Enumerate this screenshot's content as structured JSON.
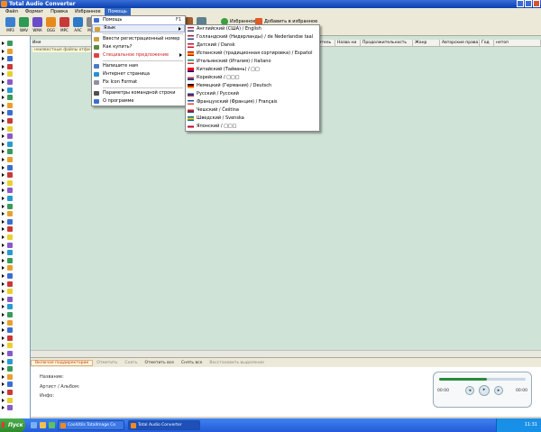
{
  "window": {
    "title": "Total Audio Converter"
  },
  "menubar": [
    "Файл",
    "Формат",
    "Правка",
    "Избранное",
    "Помощь"
  ],
  "toolbar": {
    "tools": [
      {
        "label": "MP3",
        "color": "#3a7fd0"
      },
      {
        "label": "WAV",
        "color": "#2f9a55"
      },
      {
        "label": "WMA",
        "color": "#6a4cc8"
      },
      {
        "label": "OGG",
        "color": "#e88a1a"
      },
      {
        "label": "MPC",
        "color": "#c83a3a"
      },
      {
        "label": "AAC",
        "color": "#2a7ac8"
      },
      {
        "label": "MP4",
        "color": "#888888"
      }
    ],
    "favorites_label": "Избранное",
    "add_favorites_label": "Добавить в избранное"
  },
  "filelist": {
    "columns": [
      "Имя",
      "Исполнитель",
      "Назва ни",
      "Продолжительность",
      "Жанр",
      "Авторские права",
      "Год",
      "нетоп"
    ],
    "note": "неизвестные файлы отфи"
  },
  "bottom_tabs": [
    "Включая поддиректории",
    "Отметить",
    "Снять",
    "Отметить все",
    "Снять все",
    "Восстановить выделение"
  ],
  "info": {
    "title_line": "Название:",
    "artist_line": "Артист / Альбом:",
    "info_line": "Инфо:"
  },
  "player": {
    "time_start": "00:00",
    "time_end": "00:00",
    "progress": 0.55
  },
  "help_menu": [
    {
      "label": "Помощь",
      "key": "F1",
      "icon": "help-icon",
      "color": "#3a6fd0"
    },
    {
      "label": "Язык",
      "icon": "language-icon",
      "color": "#d8a030",
      "submenu": true,
      "highlight": true
    },
    {
      "sep": true
    },
    {
      "label": "Ввести регистрационный номер",
      "icon": "key-icon",
      "color": "#c8a040"
    },
    {
      "label": "Как купить?",
      "icon": "cart-icon",
      "color": "#5a8a3a"
    },
    {
      "label": "Специальное предложение",
      "icon": "star-icon",
      "color": "#e04040",
      "red": true,
      "submenu": true
    },
    {
      "sep": true
    },
    {
      "label": "Напишите нам",
      "icon": "mail-icon",
      "color": "#4a7ac8"
    },
    {
      "label": "Интернет страница",
      "icon": "globe-icon",
      "color": "#2a90d0"
    },
    {
      "label": "Fix Icon Format",
      "icon": "fix-icon",
      "color": "#9090a0"
    },
    {
      "sep": true
    },
    {
      "label": "Параметры командной строки",
      "icon": "terminal-icon",
      "color": "#505050"
    },
    {
      "label": "О программе",
      "icon": "info-icon",
      "color": "#3a6fd0"
    }
  ],
  "language_menu": [
    {
      "label": "Английский (США) / English",
      "flag": [
        "#b22234",
        "#ffffff",
        "#3c3b6e"
      ]
    },
    {
      "label": "Голландский (Нидерланды) / de Nederlandse taal",
      "flag": [
        "#ae1c28",
        "#ffffff",
        "#21468b"
      ]
    },
    {
      "label": "Датский / Dansk",
      "flag": [
        "#c8102e",
        "#ffffff",
        "#c8102e"
      ]
    },
    {
      "label": "Испанский (традиционная сортировка) / Español",
      "flag": [
        "#c60b1e",
        "#ffc400",
        "#c60b1e"
      ]
    },
    {
      "label": "Итальянский (Италия) / Italiano",
      "flag": [
        "#009246",
        "#ffffff",
        "#ce2b37"
      ]
    },
    {
      "label": "Китайский (Тайвань) / □□",
      "flag": [
        "#fe0000",
        "#fe0000",
        "#000095"
      ]
    },
    {
      "label": "Корейский / □□□",
      "flag": [
        "#ffffff",
        "#cd2e3a",
        "#0047a0"
      ]
    },
    {
      "label": "Немецкий (Германия) / Deutsch",
      "flag": [
        "#000000",
        "#dd0000",
        "#ffce00"
      ]
    },
    {
      "label": "Русский / Русский",
      "flag": [
        "#ffffff",
        "#0039a6",
        "#d52b1e"
      ]
    },
    {
      "label": "Французский (Франция) / Français",
      "flag": [
        "#0055a4",
        "#ffffff",
        "#ef4135"
      ]
    },
    {
      "label": "Чешский / Čeština",
      "flag": [
        "#ffffff",
        "#d7141a",
        "#11457e"
      ]
    },
    {
      "label": "Шведский / Svenska",
      "flag": [
        "#006aa7",
        "#fecc00",
        "#006aa7"
      ]
    },
    {
      "label": "Японский / □□□",
      "flag": [
        "#ffffff",
        "#bc002d",
        "#ffffff"
      ]
    }
  ],
  "taskbar": {
    "start_label": "Пуск",
    "tasks": [
      {
        "label": "CoolUtils TotalImage Co"
      },
      {
        "label": "Total Audio Converter",
        "active": true
      }
    ],
    "clock": "11:31"
  }
}
